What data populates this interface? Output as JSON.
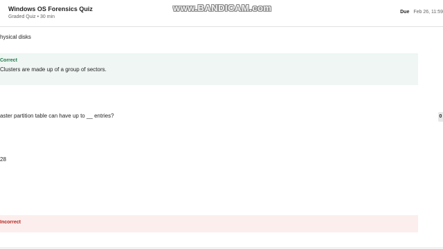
{
  "header": {
    "title": "Windows OS Forensics Quiz",
    "meta": "Graded Quiz • 30 min",
    "due_label": "Due",
    "due_value": "Feb 26, 11:59"
  },
  "watermark": "www.BANDICAM.com",
  "content": {
    "answer_option_1": "hysical disks",
    "correct_feedback": {
      "label": "Correct",
      "text": "Clusters are made up of a group of sectors."
    },
    "question_text": "aster partition table can have up to __ entries?",
    "answer_text": "28",
    "incorrect_feedback": {
      "label": "Incorrect"
    }
  },
  "side_tab": "0"
}
